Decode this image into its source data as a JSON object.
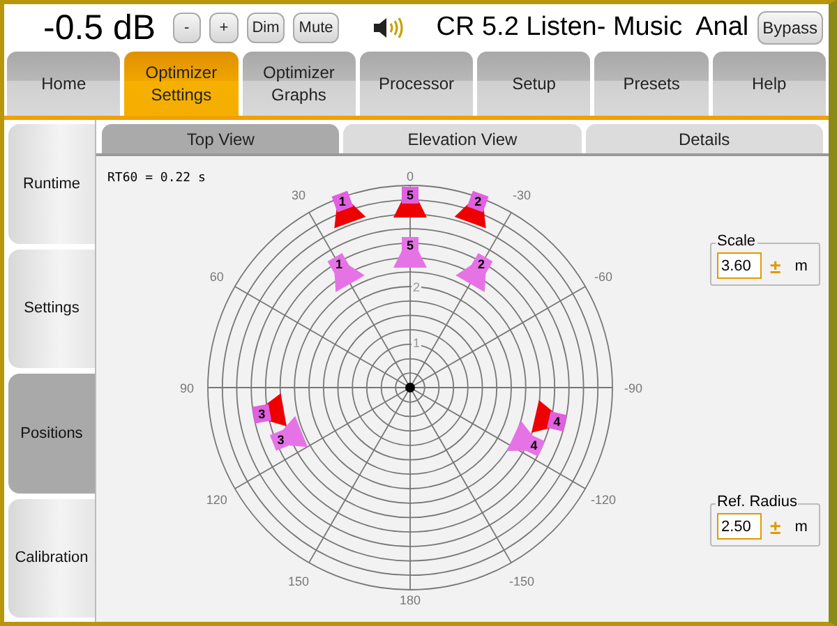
{
  "top_bar": {
    "volume": "-0.5 dB",
    "buttons": [
      "-",
      "+",
      "Dim",
      "Mute"
    ],
    "title": "CR 5.2 Listen- Music  Anal",
    "bypass": "Bypass"
  },
  "tabs": [
    {
      "label": "Home",
      "selected": false
    },
    {
      "label": "Optimizer Settings",
      "selected": true
    },
    {
      "label": "Optimizer Graphs",
      "selected": false
    },
    {
      "label": "Processor",
      "selected": false
    },
    {
      "label": "Setup",
      "selected": false
    },
    {
      "label": "Presets",
      "selected": false
    },
    {
      "label": "Help",
      "selected": false
    }
  ],
  "sidebar": {
    "items": [
      {
        "label": "Runtime",
        "selected": false
      },
      {
        "label": "Settings",
        "selected": false
      },
      {
        "label": "Positions",
        "selected": true
      },
      {
        "label": "Calibration",
        "selected": false
      }
    ]
  },
  "sub_tabs": [
    {
      "label": "Top View",
      "selected": true
    },
    {
      "label": "Elevation View",
      "selected": false
    },
    {
      "label": "Details",
      "selected": false
    }
  ],
  "plot": {
    "rt60": "RT60 = 0.22 s",
    "angle_labels": [
      "0",
      "30",
      "60",
      "90",
      "120",
      "150",
      "180",
      "-150",
      "-120",
      "-90",
      "-60",
      "-30"
    ],
    "distance_labels": [
      "2",
      "1"
    ],
    "speakers": [
      {
        "label": "1",
        "kind": "measured"
      },
      {
        "label": "5",
        "kind": "measured"
      },
      {
        "label": "2",
        "kind": "measured"
      },
      {
        "label": "1",
        "kind": "reference"
      },
      {
        "label": "5",
        "kind": "reference"
      },
      {
        "label": "2",
        "kind": "reference"
      },
      {
        "label": "3",
        "kind": "measured"
      },
      {
        "label": "3",
        "kind": "reference"
      },
      {
        "label": "4",
        "kind": "measured"
      },
      {
        "label": "4",
        "kind": "reference"
      }
    ]
  },
  "settings": [
    {
      "label": "Scale",
      "value": "3.60",
      "plus_minus": "±",
      "unit": "m"
    },
    {
      "label": "Ref. Radius",
      "value": "2.50",
      "plus_minus": "±",
      "unit": "m"
    }
  ]
}
